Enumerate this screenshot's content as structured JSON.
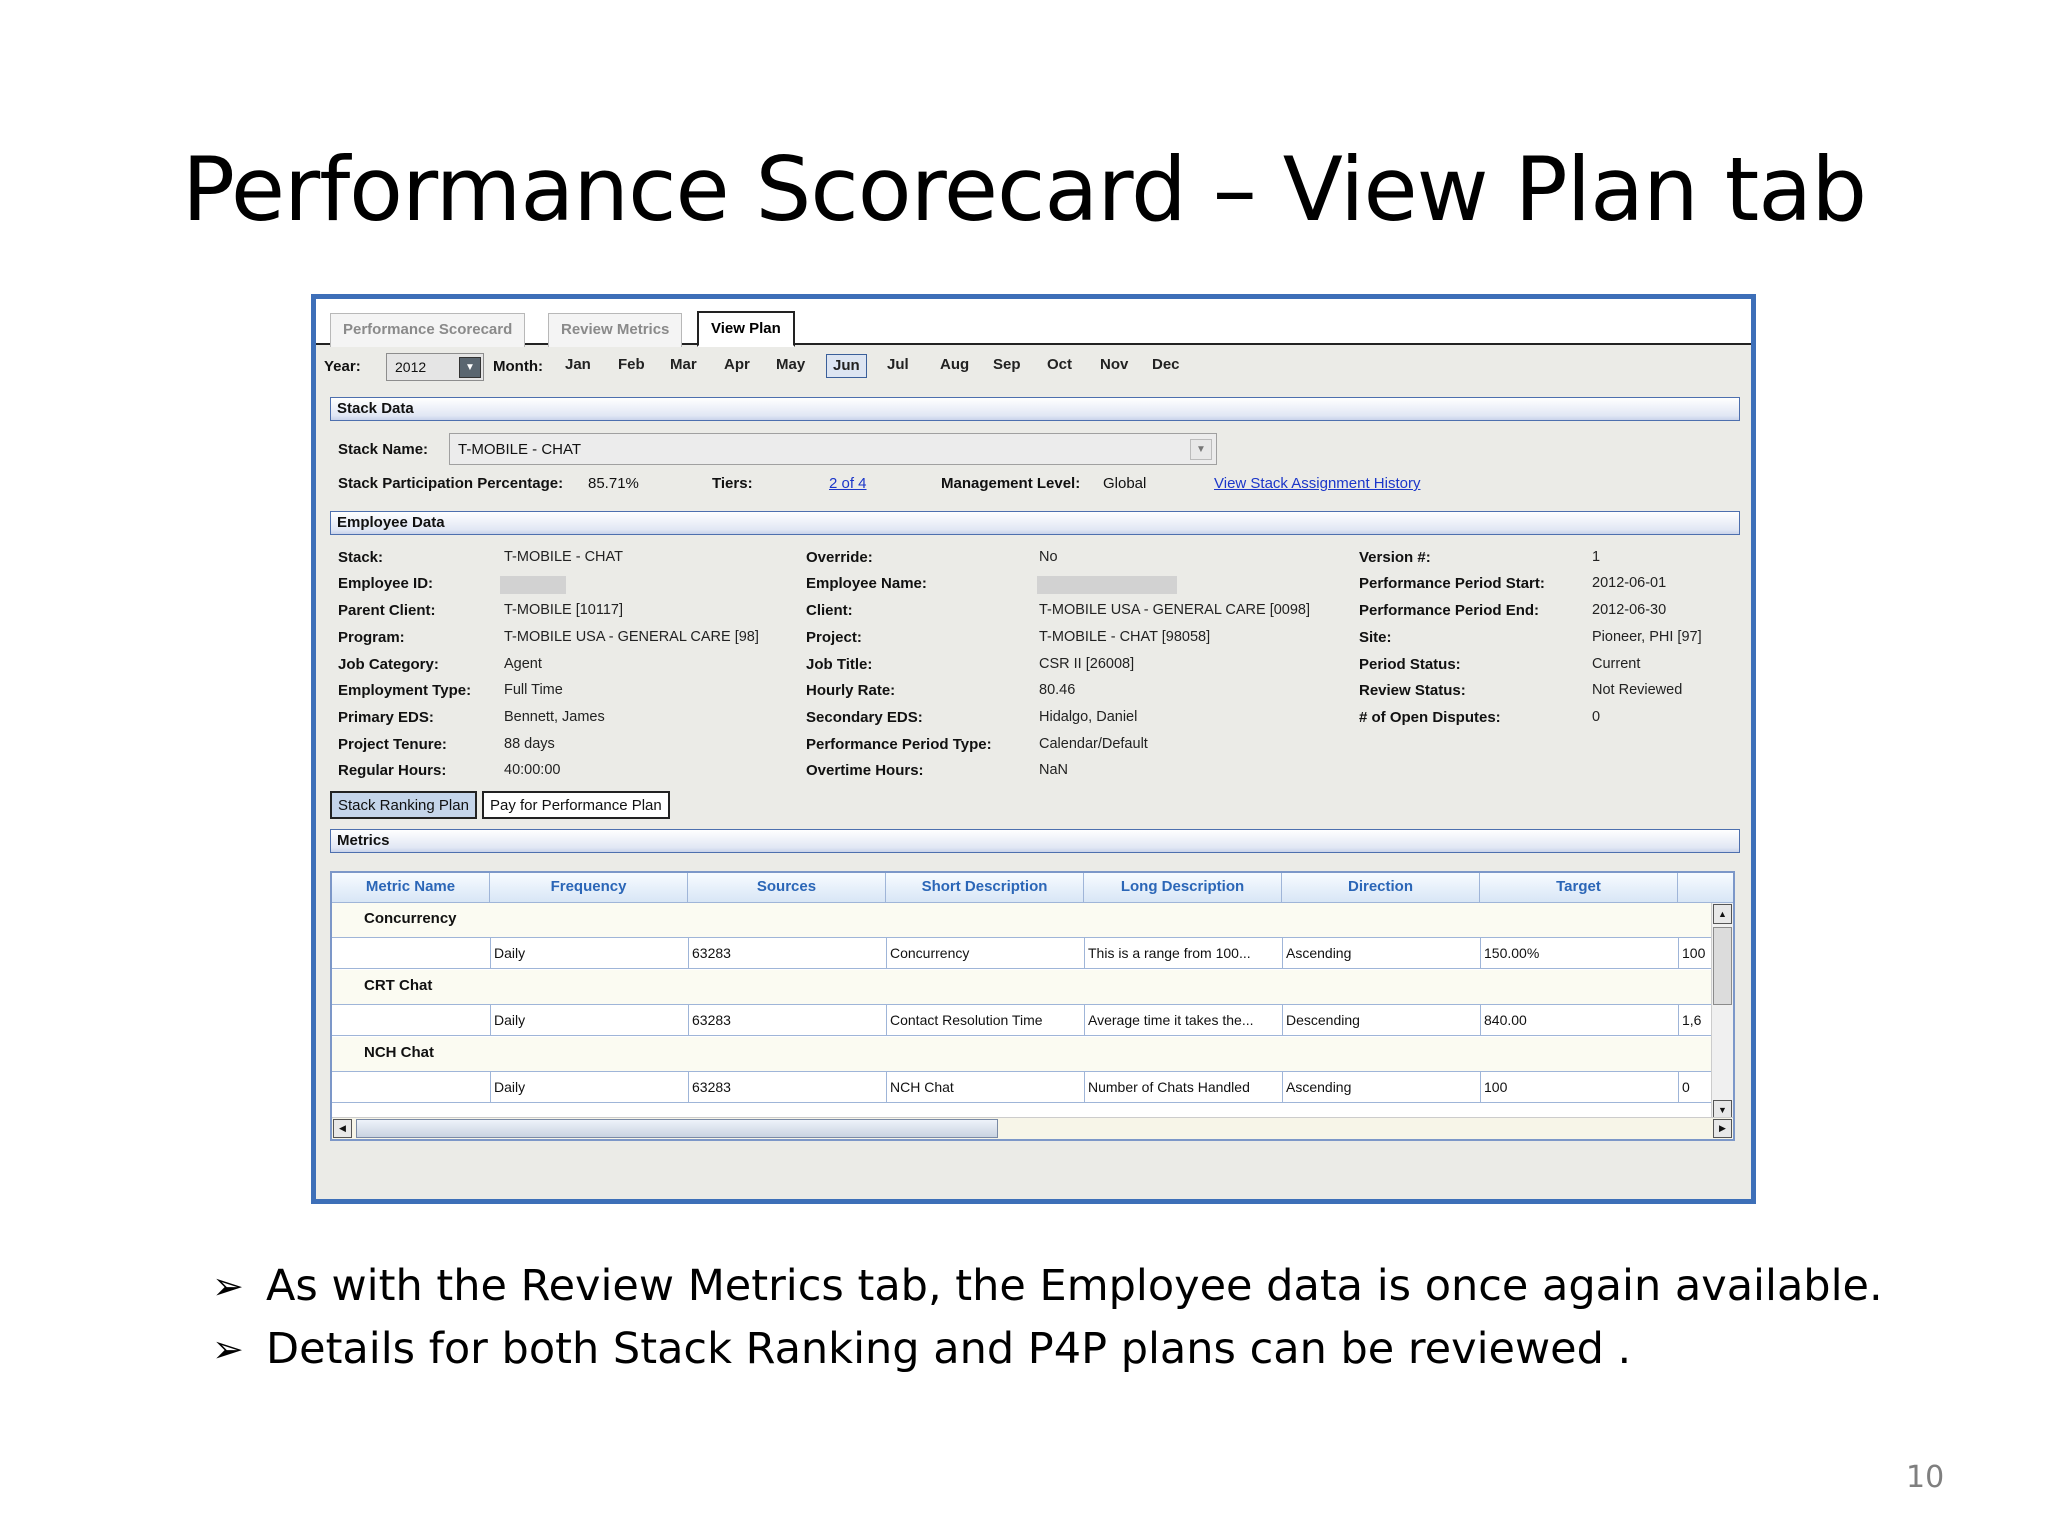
{
  "slide": {
    "title": "Performance Scorecard – View Plan tab",
    "bullets": [
      "As with the Review Metrics tab, the Employee data is once again available.",
      "Details for both Stack Ranking and P4P plans can be reviewed ."
    ],
    "page_number": "10"
  },
  "app": {
    "tabs": [
      "Performance Scorecard",
      "Review Metrics",
      "View Plan"
    ],
    "active_tab": "View Plan",
    "year_label": "Year:",
    "year_value": "2012",
    "month_label": "Month:",
    "months": [
      "Jan",
      "Feb",
      "Mar",
      "Apr",
      "May",
      "Jun",
      "Jul",
      "Aug",
      "Sep",
      "Oct",
      "Nov",
      "Dec"
    ],
    "selected_month": "Jun",
    "stack_data": {
      "section_title": "Stack Data",
      "stack_name_label": "Stack Name:",
      "stack_name_value": "T-MOBILE - CHAT",
      "participation_label": "Stack Participation Percentage:",
      "participation_value": "85.71%",
      "tiers_label": "Tiers:",
      "tiers_value": "2 of 4",
      "mgmt_label": "Management Level:",
      "mgmt_value": "Global",
      "history_link": "View Stack Assignment History"
    },
    "employee_data": {
      "section_title": "Employee Data",
      "col1": [
        {
          "label": "Stack:",
          "value": "T-MOBILE - CHAT"
        },
        {
          "label": "Employee ID:",
          "value": ""
        },
        {
          "label": "Parent Client:",
          "value": "T-MOBILE [10117]"
        },
        {
          "label": "Program:",
          "value": "T-MOBILE USA - GENERAL CARE [98]"
        },
        {
          "label": "Job Category:",
          "value": "Agent"
        },
        {
          "label": "Employment Type:",
          "value": "Full Time"
        },
        {
          "label": "Primary EDS:",
          "value": "Bennett, James"
        },
        {
          "label": "Project Tenure:",
          "value": "88 days"
        },
        {
          "label": "Regular Hours:",
          "value": "40:00:00"
        }
      ],
      "col2": [
        {
          "label": "Override:",
          "value": "No"
        },
        {
          "label": "Employee Name:",
          "value": ""
        },
        {
          "label": "Client:",
          "value": "T-MOBILE USA - GENERAL CARE [0098]"
        },
        {
          "label": "Project:",
          "value": "T-MOBILE - CHAT [98058]"
        },
        {
          "label": "Job Title:",
          "value": "CSR II [26008]"
        },
        {
          "label": "Hourly Rate:",
          "value": "80.46"
        },
        {
          "label": "Secondary EDS:",
          "value": "Hidalgo, Daniel"
        },
        {
          "label": "Performance Period Type:",
          "value": "Calendar/Default"
        },
        {
          "label": "Overtime Hours:",
          "value": "NaN"
        }
      ],
      "col3": [
        {
          "label": "Version #:",
          "value": "1"
        },
        {
          "label": "Performance Period Start:",
          "value": "2012-06-01"
        },
        {
          "label": "Performance Period End:",
          "value": "2012-06-30"
        },
        {
          "label": "Site:",
          "value": "Pioneer, PHI [97]"
        },
        {
          "label": "Period Status:",
          "value": "Current"
        },
        {
          "label": "Review Status:",
          "value": "Not Reviewed"
        },
        {
          "label": "# of Open Disputes:",
          "value": "0"
        }
      ]
    },
    "plan_buttons": [
      "Stack Ranking Plan",
      "Pay for Performance Plan"
    ],
    "metrics": {
      "section_title": "Metrics",
      "columns": [
        "Metric Name",
        "Frequency",
        "Sources",
        "Short Description",
        "Long Description",
        "Direction",
        "Target"
      ],
      "groups": [
        {
          "name": "Concurrency",
          "row": [
            "",
            "Daily",
            "63283",
            "Concurrency",
            "This is a range from 100...",
            "Ascending",
            "150.00%",
            "100"
          ]
        },
        {
          "name": "CRT Chat",
          "row": [
            "",
            "Daily",
            "63283",
            "Contact Resolution Time",
            "Average time it takes the...",
            "Descending",
            "840.00",
            "1,6"
          ]
        },
        {
          "name": "NCH Chat",
          "row": [
            "",
            "Daily",
            "63283",
            "NCH Chat",
            "Number of Chats Handled",
            "Ascending",
            "100",
            "0"
          ]
        }
      ]
    },
    "colors": {
      "frame_border": "#3d6fb8",
      "header_text": "#2b66b7",
      "link": "#1b36c9"
    }
  }
}
